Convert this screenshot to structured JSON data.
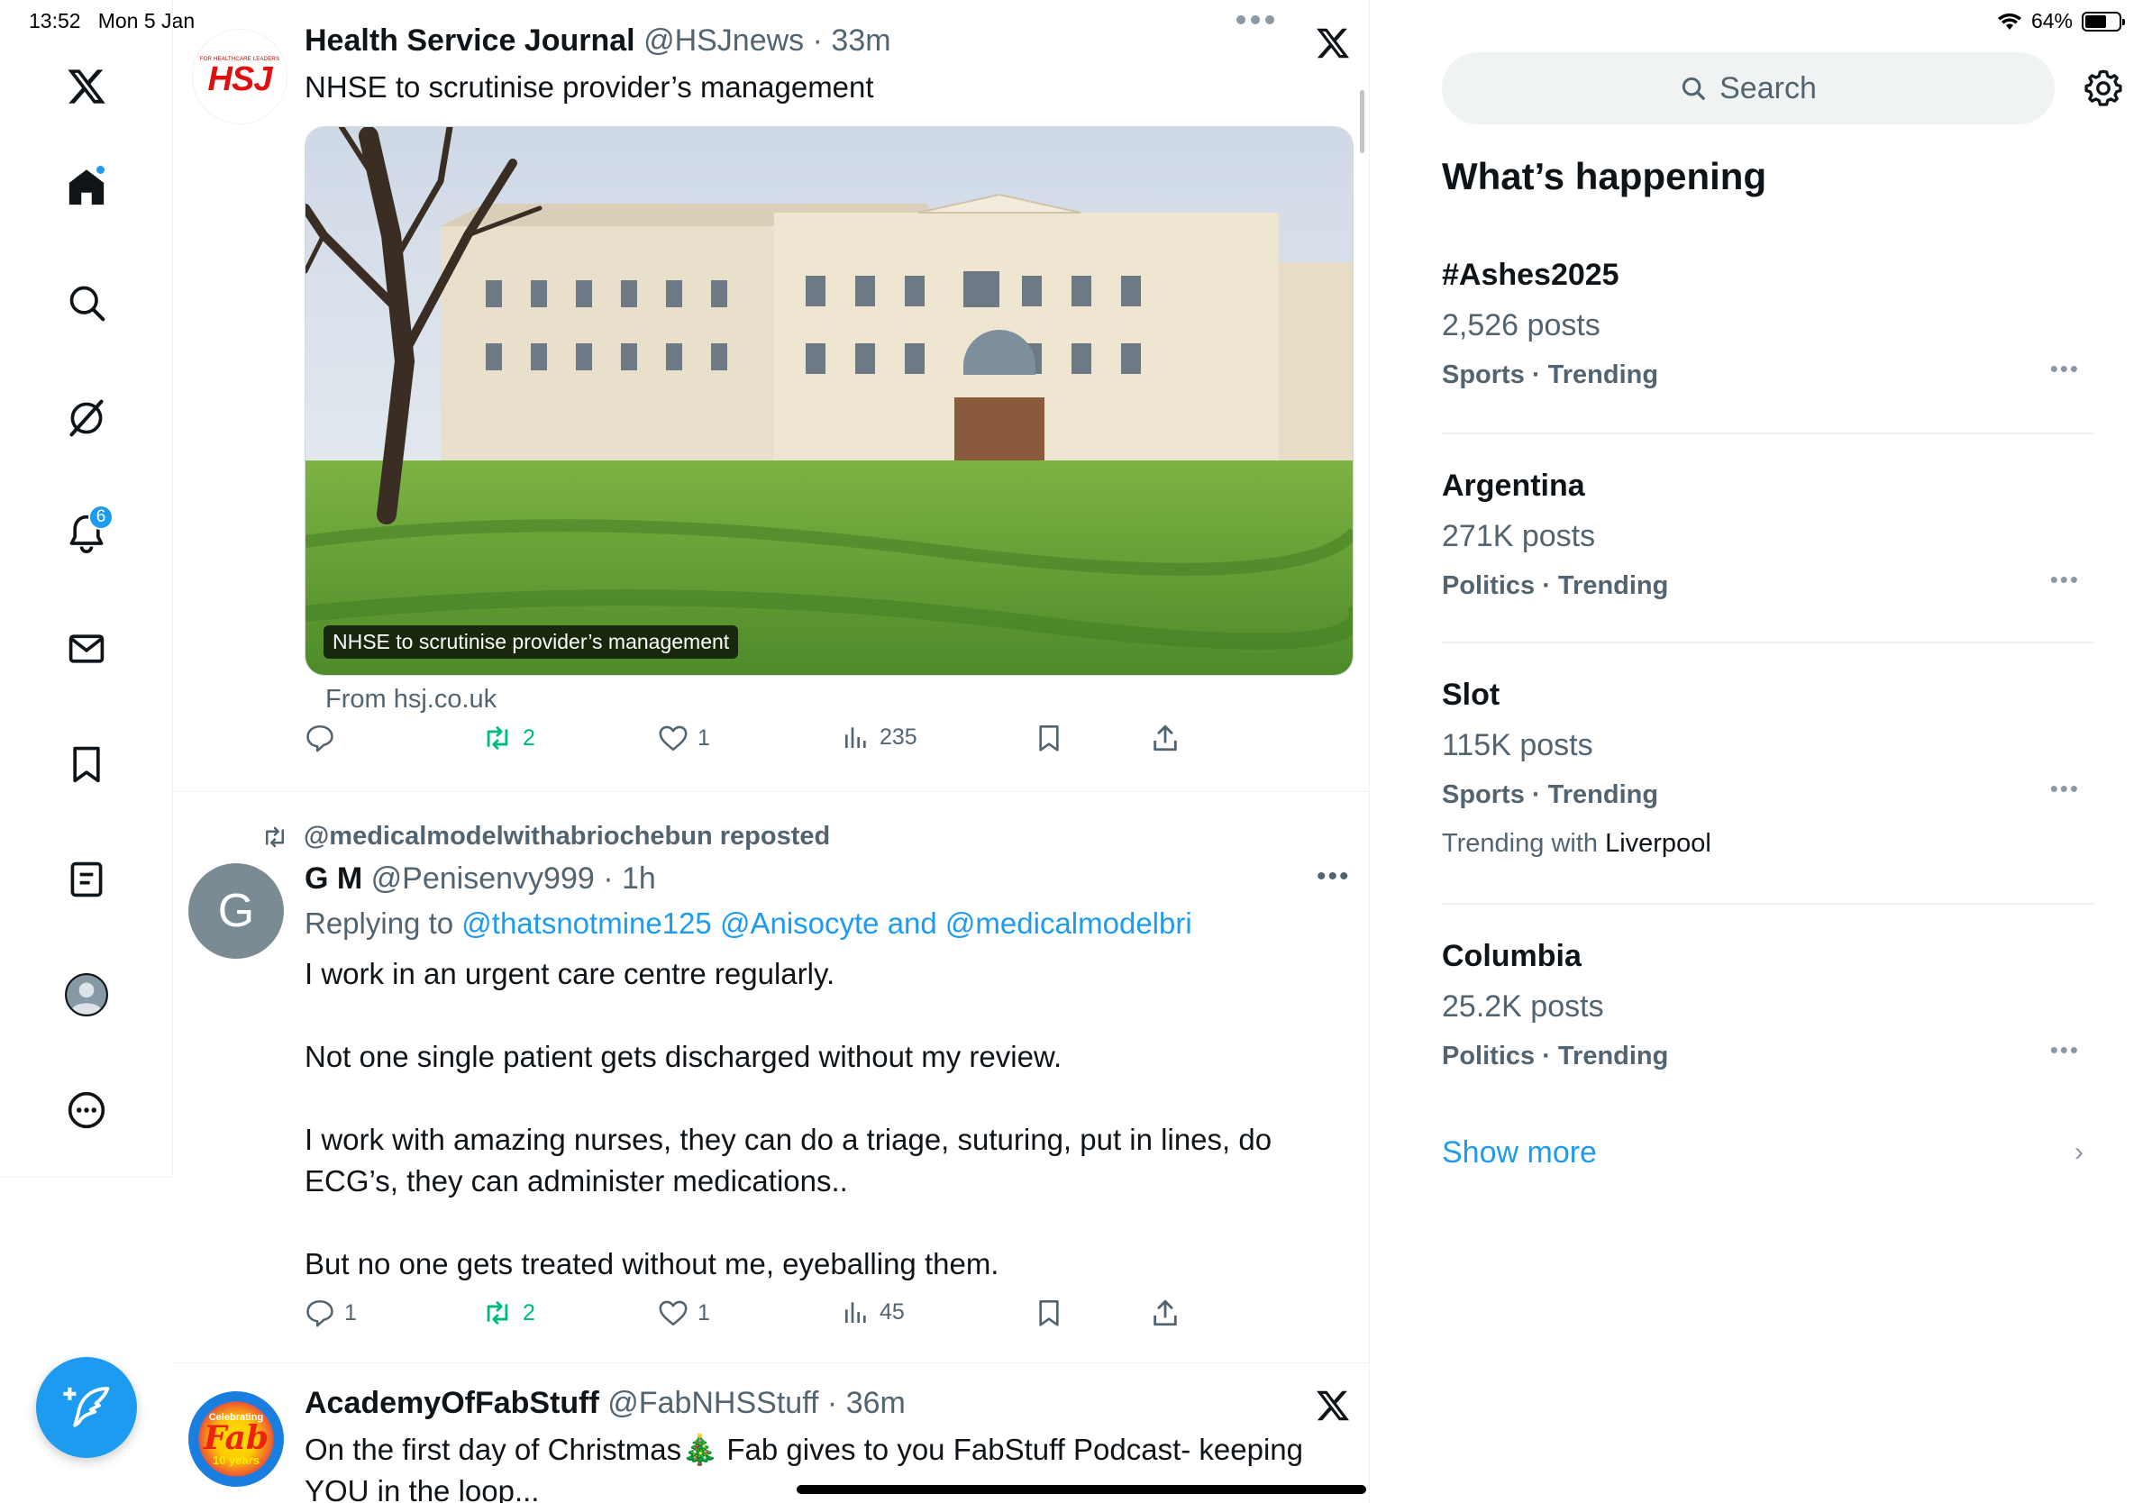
{
  "status_bar": {
    "time": "13:52",
    "date": "Mon 5 Jan",
    "battery_percent": "64%",
    "battery_level": 0.64
  },
  "nav": {
    "items": [
      {
        "name": "x-logo-icon"
      },
      {
        "name": "home-icon"
      },
      {
        "name": "search-icon"
      },
      {
        "name": "grok-icon"
      },
      {
        "name": "notifications-icon"
      },
      {
        "name": "messages-icon"
      },
      {
        "name": "bookmarks-icon"
      },
      {
        "name": "lists-icon"
      },
      {
        "name": "profile-icon"
      },
      {
        "name": "more-icon"
      }
    ],
    "notification_count": "6",
    "compose_icon": "feather-plus-icon"
  },
  "colors": {
    "accent": "#1d9bf0",
    "repost_green": "#00ba7c",
    "secondary_text": "#536471",
    "border": "#eff3f4"
  },
  "tweets": [
    {
      "name": "Health Service Journal",
      "handle": "@HSJnews",
      "time": "33m",
      "text": "NHSE to scrutinise provider’s management",
      "avatar_text": "HSJ",
      "avatar_small": "FOR HEALTHCARE LEADERS",
      "media_caption": "NHSE to scrutinise provider’s management",
      "link_source": "From hsj.co.uk",
      "replies": "",
      "reposts": "2",
      "likes": "1",
      "views": "235"
    },
    {
      "reposted_by": "@medicalmodelwithabriochebun reposted",
      "name": "G M",
      "handle": "@Penisenvy999",
      "time": "1h",
      "avatar_letter": "G",
      "replying_prefix": "Replying to",
      "replying_to": "@thatsnotmine125 @Anisocyte and @medicalmodelbri",
      "text": "I work in an urgent care centre regularly.\n\nNot one single patient gets discharged without my review.\n\nI work with amazing nurses, they can do a triage, suturing, put in lines, do ECG’s, they can administer medications..\n\nBut no one gets treated without me, eyeballing them.",
      "replies": "1",
      "reposts": "2",
      "likes": "1",
      "views": "45"
    },
    {
      "name": "AcademyOfFabStuff",
      "handle": "@FabNHSStuff",
      "time": "36m",
      "avatar_top": "Celebrating",
      "avatar_mid": "Fab",
      "avatar_bottom": "10 years",
      "text": "On the first day of Christmas🎄 Fab gives to you FabStuff Podcast- keeping YOU in the loop..."
    }
  ],
  "sidebar": {
    "search_placeholder": "Search",
    "section_title": "What’s happening",
    "trends": [
      {
        "name": "#Ashes2025",
        "posts": "2,526 posts",
        "category": "Sports · Trending"
      },
      {
        "name": "Argentina",
        "posts": "271K posts",
        "category": "Politics · Trending"
      },
      {
        "name": "Slot",
        "posts": "115K posts",
        "category": "Sports · Trending",
        "with_prefix": "Trending with",
        "with_term": "Liverpool"
      },
      {
        "name": "Columbia",
        "posts": "25.2K posts",
        "category": "Politics · Trending"
      }
    ],
    "show_more": "Show more"
  }
}
